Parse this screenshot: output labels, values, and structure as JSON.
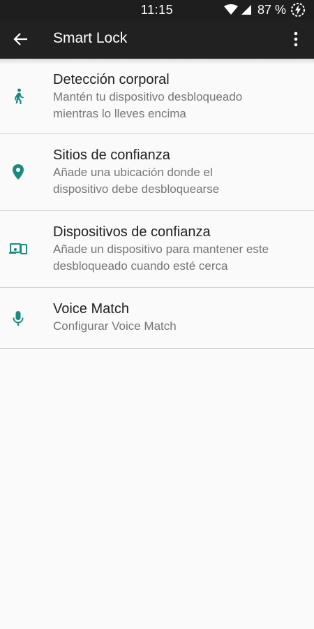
{
  "status_bar": {
    "time": "11:15",
    "battery": "87 %"
  },
  "app_bar": {
    "title": "Smart Lock"
  },
  "items": [
    {
      "title": "Detección corporal",
      "subtitle_line1": "Mantén tu dispositivo desbloqueado",
      "subtitle_line2": "mientras lo lleves encima",
      "icon": "walking-person-icon"
    },
    {
      "title": "Sitios de confianza",
      "subtitle_line1": "Añade una ubicación donde el",
      "subtitle_line2": "dispositivo debe desbloquearse",
      "icon": "location-pin-icon"
    },
    {
      "title": "Dispositivos de confianza",
      "subtitle_line1": "Añade un dispositivo para mantener este",
      "subtitle_line2": "desbloqueado cuando esté cerca",
      "icon": "devices-icon"
    },
    {
      "title": "Voice Match",
      "subtitle_line1": "Configurar Voice Match",
      "icon": "microphone-icon"
    }
  ],
  "colors": {
    "accent": "#1a8a7e",
    "app_bar": "#212121",
    "background": "#fafafa"
  }
}
